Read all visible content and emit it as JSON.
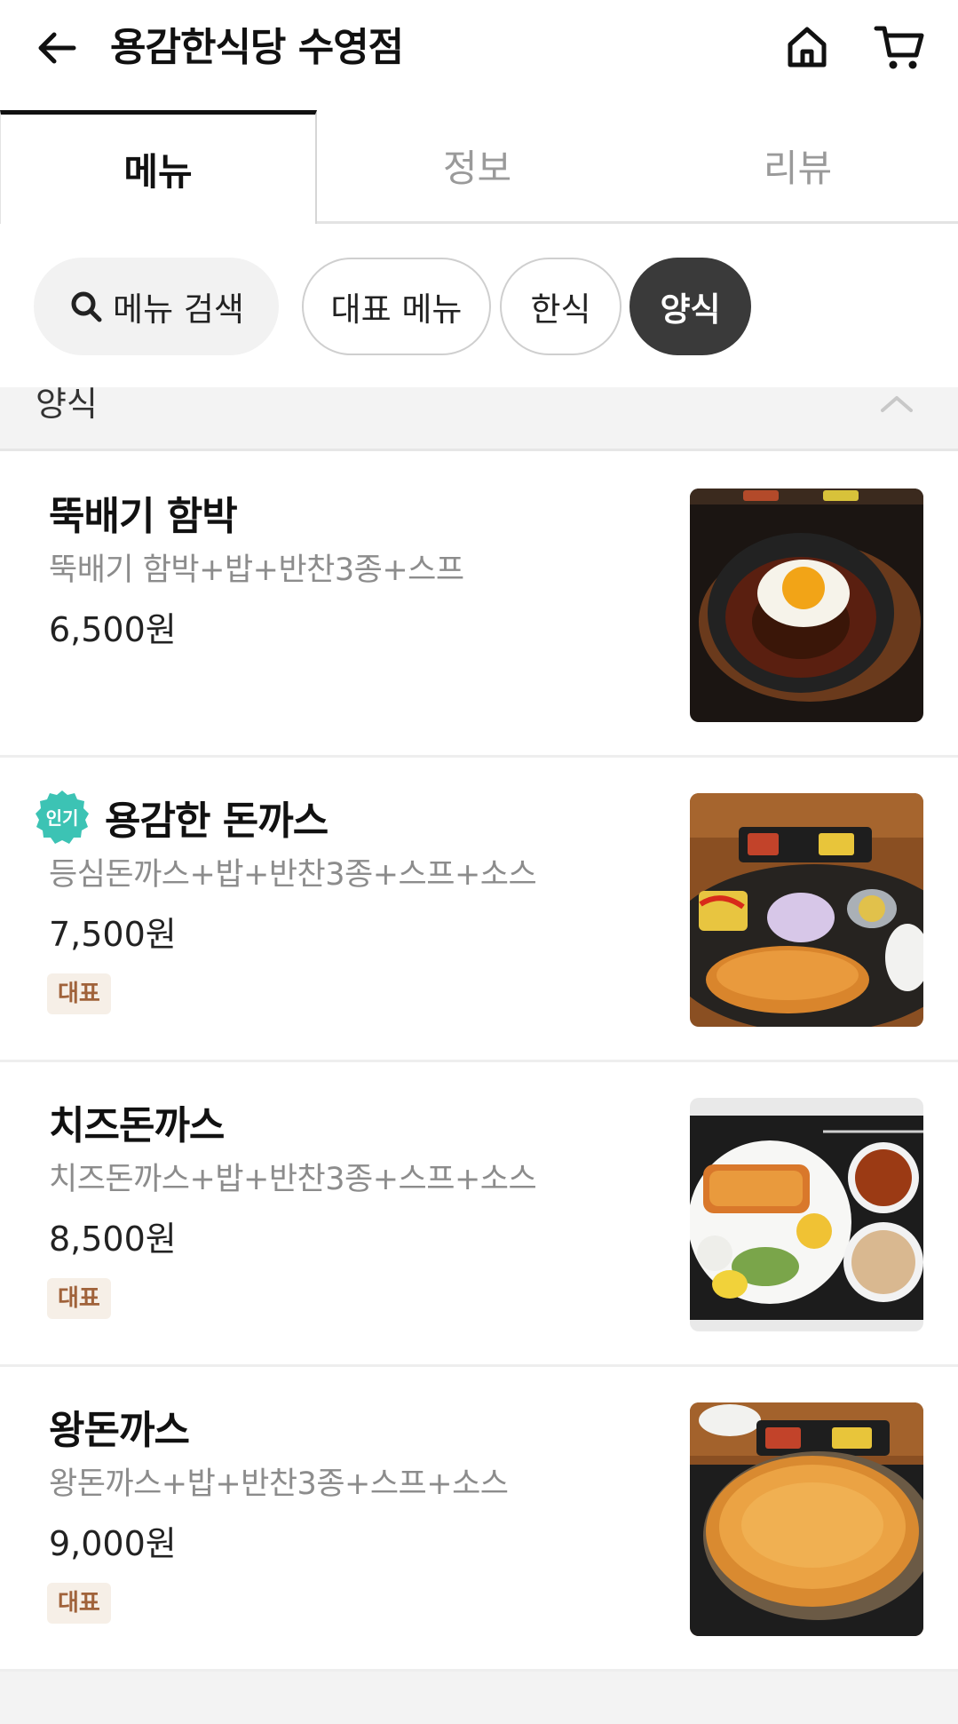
{
  "header": {
    "title": "용감한식당 수영점",
    "back_icon": "arrow-left-icon",
    "home_icon": "home-icon",
    "cart_icon": "cart-icon"
  },
  "tabs": [
    {
      "label": "메뉴",
      "active": true
    },
    {
      "label": "정보",
      "active": false
    },
    {
      "label": "리뷰",
      "active": false
    }
  ],
  "chips": {
    "search": {
      "label": "메뉴 검색",
      "icon": "search-icon"
    },
    "items": [
      {
        "label": "대표 메뉴",
        "selected": false
      },
      {
        "label": "한식",
        "selected": false
      },
      {
        "label": "양식",
        "selected": true
      }
    ]
  },
  "section": {
    "title": "양식",
    "expanded": true,
    "icon": "chevron-up-icon"
  },
  "menu_items": [
    {
      "name": "뚝배기 함박",
      "desc": "뚝배기 함박+밥+반찬3종+스프",
      "price": "6,500원",
      "tag": "",
      "popular_badge": ""
    },
    {
      "name": "용감한 돈까스",
      "desc": "등심돈까스+밥+반찬3종+스프+소스",
      "price": "7,500원",
      "tag": "대표",
      "popular_badge": "인기"
    },
    {
      "name": "치즈돈까스",
      "desc": "치즈돈까스+밥+반찬3종+스프+소스",
      "price": "8,500원",
      "tag": "대표",
      "popular_badge": ""
    },
    {
      "name": "왕돈까스",
      "desc": "왕돈까스+밥+반찬3종+스프+소스",
      "price": "9,000원",
      "tag": "대표",
      "popular_badge": ""
    }
  ],
  "colors": {
    "accent_dark": "#3a3a3a",
    "badge_teal": "#3cc3b4",
    "tag_bg": "#f6efe7",
    "tag_text": "#a0623a"
  }
}
